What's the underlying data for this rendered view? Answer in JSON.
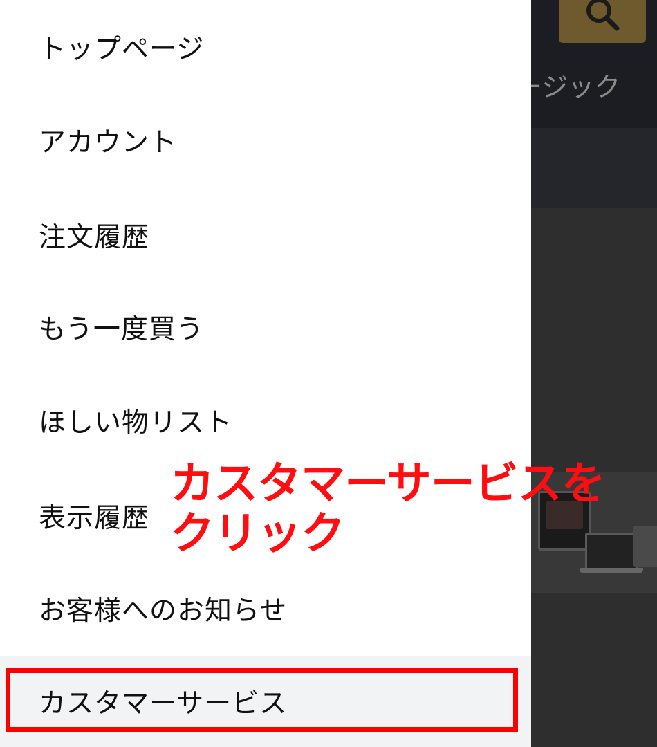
{
  "menu": {
    "items": [
      {
        "label": "トップページ"
      },
      {
        "label": "アカウント"
      },
      {
        "label": "注文履歴"
      },
      {
        "label": "もう一度買う"
      },
      {
        "label": "ほしい物リスト"
      },
      {
        "label": "表示履歴"
      },
      {
        "label": "お客様へのお知らせ"
      },
      {
        "label": "カスタマーサービス"
      }
    ]
  },
  "background": {
    "nav_text": "ージック"
  },
  "annotation": {
    "line1": "カスタマーサービスを",
    "line2": "クリック"
  },
  "icons": {
    "search": "search-icon"
  },
  "colors": {
    "annotation": "#ff0d10",
    "highlight_border": "#ff0000",
    "search_button": "#6e5a2c",
    "highlighted_item_bg": "#f2f3f5"
  }
}
